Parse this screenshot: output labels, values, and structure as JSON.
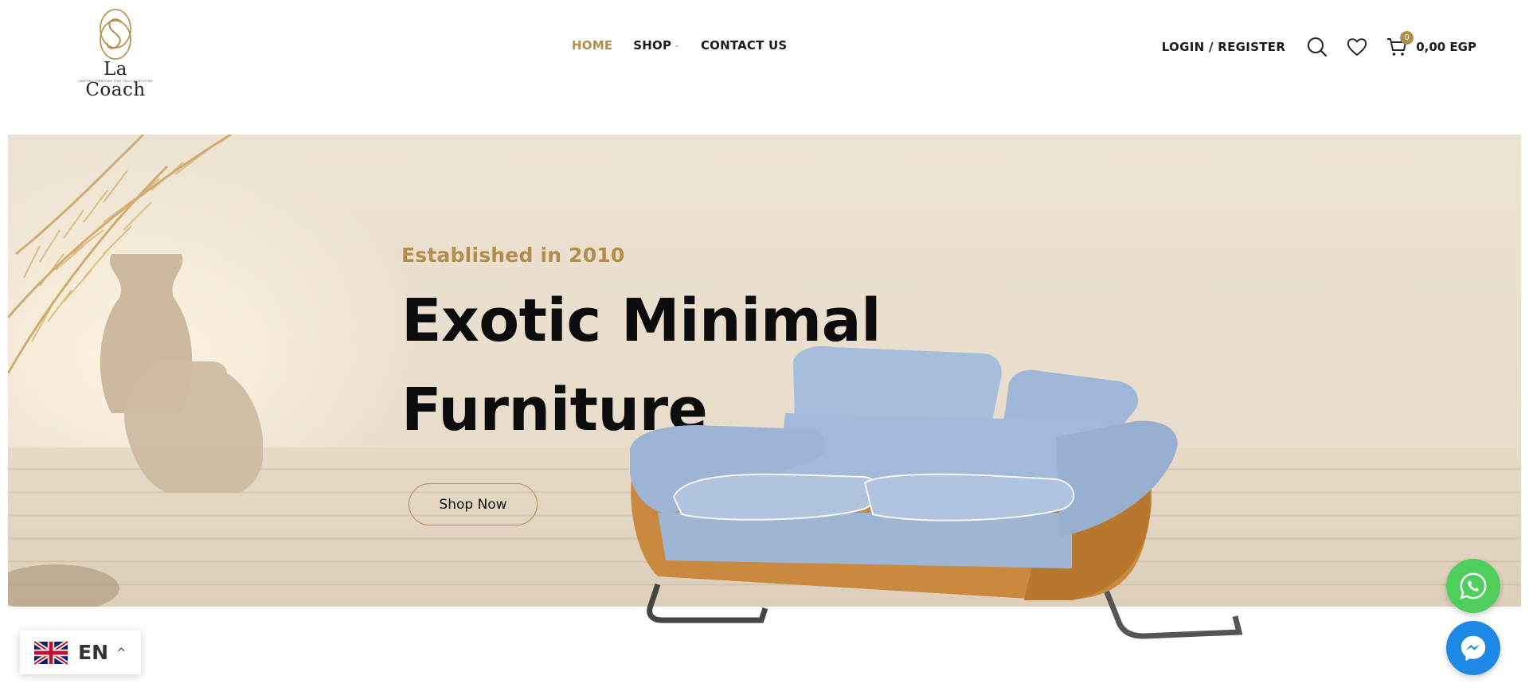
{
  "brand": {
    "logo_text": "La Coach",
    "tagline": "CRAFTING FURNITURE THAT TELLS YOUR STORY",
    "accent_color": "#b38d4a"
  },
  "nav": {
    "items": [
      {
        "label": "HOME",
        "active": true
      },
      {
        "label": "SHOP",
        "active": false,
        "has_dropdown": true
      },
      {
        "label": "CONTACT US",
        "active": false
      }
    ]
  },
  "header_actions": {
    "login_label": "LOGIN / REGISTER",
    "search_icon": "search-icon",
    "wishlist_icon": "heart-icon",
    "cart_icon": "cart-icon",
    "cart_count": "0",
    "cart_total": "0,00 EGP"
  },
  "hero": {
    "tagline": "Established in 2010",
    "headline_line1": "Exotic Minimal",
    "headline_line2": "Furniture",
    "cta_label": "Shop Now"
  },
  "language_switcher": {
    "label": "EN",
    "flag_icon": "uk-flag-icon"
  },
  "chat_buttons": {
    "whatsapp_icon": "whatsapp-icon",
    "messenger_icon": "messenger-icon",
    "whatsapp_color": "#4fce5d",
    "messenger_color": "#1e88e5"
  }
}
